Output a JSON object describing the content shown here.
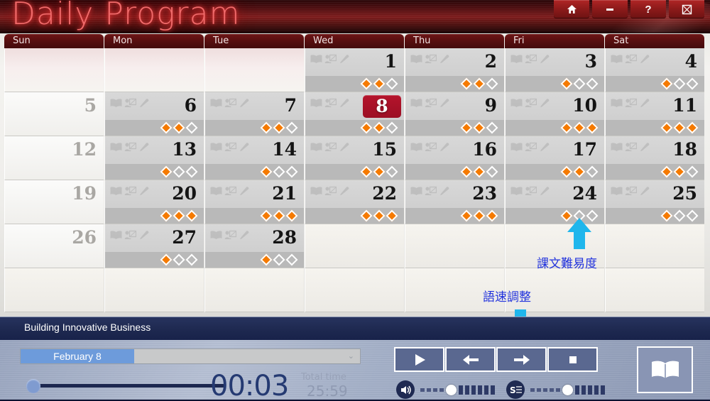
{
  "window": {
    "title": "Daily Program",
    "buttons": [
      {
        "name": "home-button",
        "icon": "home-icon",
        "label": "⌂"
      },
      {
        "name": "minimize-button",
        "icon": "minimize-icon",
        "label": "—"
      },
      {
        "name": "help-button",
        "icon": "question-icon",
        "label": "?"
      },
      {
        "name": "close-button",
        "icon": "close-icon",
        "label": "⊠"
      }
    ]
  },
  "calendar": {
    "day_headers": [
      "Sun",
      "Mon",
      "Tue",
      "Wed",
      "Thu",
      "Fri",
      "Sat"
    ],
    "today": 8,
    "lesson_icons": [
      "book-icon",
      "board-icon",
      "pencil-icon"
    ],
    "difficulty_max": 3,
    "weeks": [
      [
        {
          "day": "",
          "state": "lead"
        },
        {
          "day": "",
          "state": "lead"
        },
        {
          "day": "",
          "state": "lead"
        },
        {
          "day": "1",
          "state": "on",
          "difficulty": 2
        },
        {
          "day": "2",
          "state": "on",
          "difficulty": 2
        },
        {
          "day": "3",
          "state": "on",
          "difficulty": 1
        },
        {
          "day": "4",
          "state": "on",
          "difficulty": 1
        }
      ],
      [
        {
          "day": "5",
          "state": "off"
        },
        {
          "day": "6",
          "state": "on",
          "difficulty": 2
        },
        {
          "day": "7",
          "state": "on",
          "difficulty": 2
        },
        {
          "day": "8",
          "state": "on",
          "difficulty": 2,
          "today": true
        },
        {
          "day": "9",
          "state": "on",
          "difficulty": 2
        },
        {
          "day": "10",
          "state": "on",
          "difficulty": 3
        },
        {
          "day": "11",
          "state": "on",
          "difficulty": 3
        }
      ],
      [
        {
          "day": "12",
          "state": "off"
        },
        {
          "day": "13",
          "state": "on",
          "difficulty": 1
        },
        {
          "day": "14",
          "state": "on",
          "difficulty": 1
        },
        {
          "day": "15",
          "state": "on",
          "difficulty": 2
        },
        {
          "day": "16",
          "state": "on",
          "difficulty": 2
        },
        {
          "day": "17",
          "state": "on",
          "difficulty": 2
        },
        {
          "day": "18",
          "state": "on",
          "difficulty": 2
        }
      ],
      [
        {
          "day": "19",
          "state": "off"
        },
        {
          "day": "20",
          "state": "on",
          "difficulty": 3
        },
        {
          "day": "21",
          "state": "on",
          "difficulty": 3
        },
        {
          "day": "22",
          "state": "on",
          "difficulty": 3
        },
        {
          "day": "23",
          "state": "on",
          "difficulty": 3
        },
        {
          "day": "24",
          "state": "on",
          "difficulty": 1
        },
        {
          "day": "25",
          "state": "on",
          "difficulty": 1
        }
      ],
      [
        {
          "day": "26",
          "state": "off"
        },
        {
          "day": "27",
          "state": "on",
          "difficulty": 1
        },
        {
          "day": "28",
          "state": "on",
          "difficulty": 1
        },
        {
          "day": "",
          "state": "blank"
        },
        {
          "day": "",
          "state": "blank"
        },
        {
          "day": "",
          "state": "blank"
        },
        {
          "day": "",
          "state": "blank"
        }
      ],
      [
        {
          "day": "",
          "state": "blank"
        },
        {
          "day": "",
          "state": "blank"
        },
        {
          "day": "",
          "state": "blank"
        },
        {
          "day": "",
          "state": "blank"
        },
        {
          "day": "",
          "state": "blank"
        },
        {
          "day": "",
          "state": "blank"
        },
        {
          "day": "",
          "state": "blank"
        }
      ]
    ]
  },
  "annotations": {
    "difficulty": {
      "text": "課文難易度",
      "color": "#2233dd",
      "arrow": "up"
    },
    "speed": {
      "text": "語速調整",
      "color": "#2233dd",
      "arrow": "down"
    }
  },
  "player": {
    "lesson_title": "Building Innovative Business",
    "date_select": "February 8",
    "current_time": "00:03",
    "total_time_label": "Total time",
    "total_time": "25:59",
    "seek_percent": 4,
    "transport": [
      {
        "name": "play-button",
        "icon": "play-icon"
      },
      {
        "name": "previous-button",
        "icon": "arrow-left-icon"
      },
      {
        "name": "next-button",
        "icon": "arrow-right-icon"
      },
      {
        "name": "stop-button",
        "icon": "stop-icon"
      }
    ],
    "volume": {
      "icon": "speaker-icon",
      "empty": 4,
      "filled": 6
    },
    "speed": {
      "icon": "speed-icon",
      "empty": 5,
      "filled": 5
    },
    "book_button": {
      "name": "book-button",
      "icon": "open-book-icon"
    }
  },
  "colors": {
    "title_red": "#7e1d1d",
    "today_red": "#b5142c",
    "diamond_orange": "#f57a00",
    "player_navy": "#1e2950",
    "annotation_blue": "#2233dd",
    "arrow_cyan": "#1fb6ec"
  }
}
